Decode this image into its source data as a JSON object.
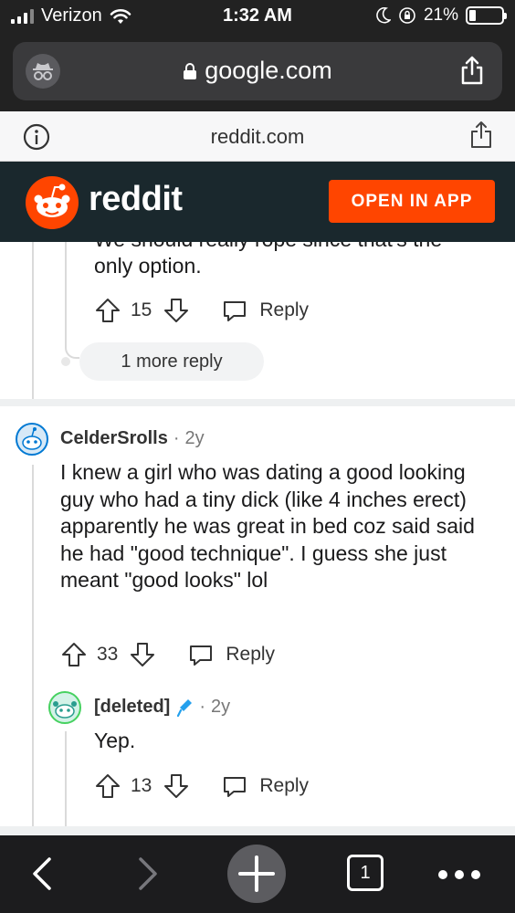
{
  "status_bar": {
    "carrier": "Verizon",
    "time": "1:32 AM",
    "battery": "21%",
    "battery_level": 0.21
  },
  "browser": {
    "url": "google.com",
    "site": "reddit.com"
  },
  "reddit_header": {
    "wordmark": "reddit",
    "open_in_app": "OPEN IN APP",
    "brand_color": "#ff4500"
  },
  "comments": [
    {
      "cut_text": "We should really rope since that's the",
      "text": "only option.",
      "votes": "15",
      "reply_label": "Reply",
      "more_replies": "1 more reply"
    },
    {
      "user": "CelderSrolls",
      "age": "2y",
      "text": "I knew a girl who was dating a good looking guy who had a tiny dick (like 4 inches erect) apparently he was great in bed coz said said he had \"good technique\". I guess she just meant \"good looks\" lol",
      "votes": "33",
      "reply_label": "Reply"
    },
    {
      "user": "[deleted]",
      "age": "2y",
      "text": "Yep.",
      "votes": "13",
      "reply_label": "Reply"
    }
  ],
  "toolbar": {
    "tab_count": "1"
  },
  "icons": {
    "back": "chevron-left-icon",
    "forward": "chevron-right-icon",
    "new_tab": "plus-icon",
    "tabs": "tabs-icon",
    "more": "more-icon"
  }
}
